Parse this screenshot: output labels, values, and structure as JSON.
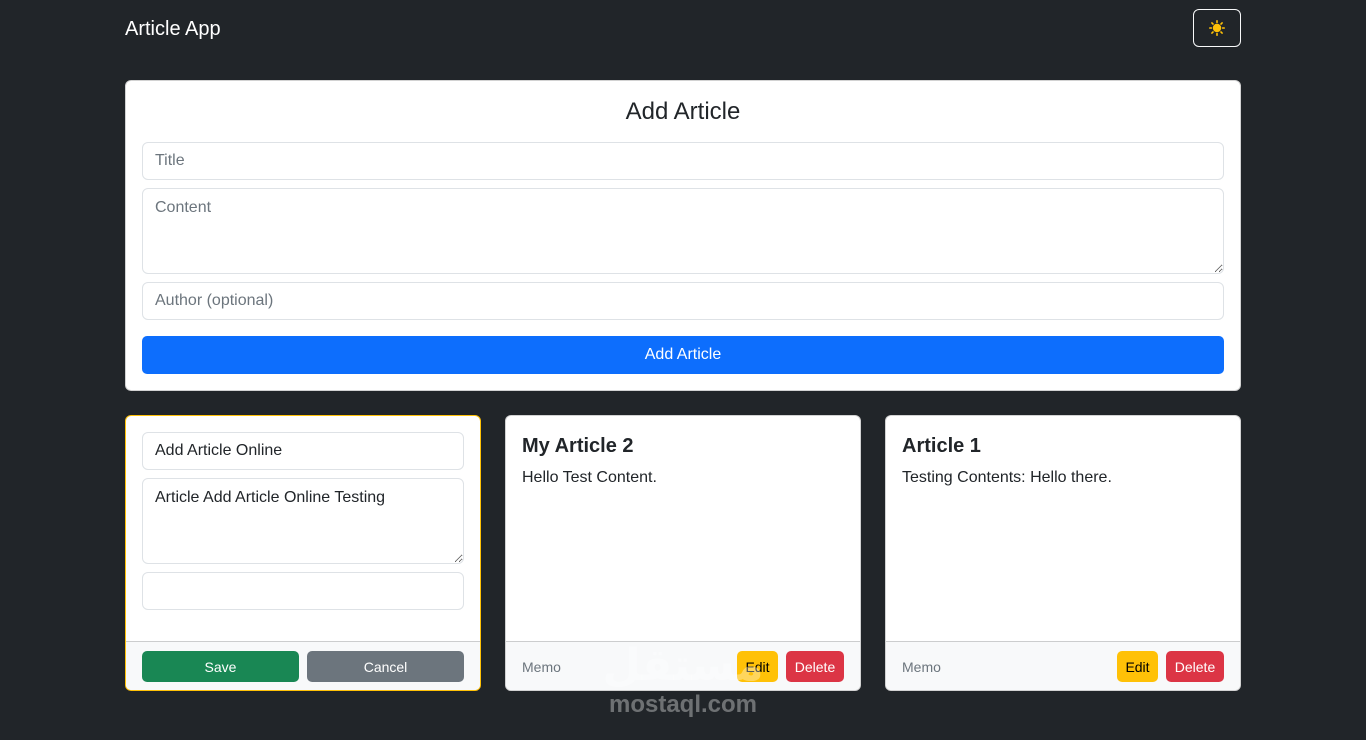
{
  "navbar": {
    "brand": "Article App",
    "theme_icon": "sun-icon",
    "accent": "#ffc107"
  },
  "add_form": {
    "heading": "Add Article",
    "title_placeholder": "Title",
    "content_placeholder": "Content",
    "author_placeholder": "Author (optional)",
    "submit_label": "Add Article"
  },
  "edit_card": {
    "title_value": "Add Article Online",
    "content_value": "Article Add Article Online Testing",
    "author_value": "",
    "save_label": "Save",
    "cancel_label": "Cancel"
  },
  "articles": [
    {
      "title": "My Article 2",
      "content": "Hello Test Content.",
      "author": "Memo",
      "edit_label": "Edit",
      "delete_label": "Delete"
    },
    {
      "title": "Article 1",
      "content": "Testing Contents: Hello there.",
      "author": "Memo",
      "edit_label": "Edit",
      "delete_label": "Delete"
    }
  ],
  "watermark": {
    "logo": "مستقل",
    "text": "mostaql.com"
  },
  "colors": {
    "background": "#212529",
    "primary": "#0d6efd",
    "success": "#198754",
    "secondary": "#6c757d",
    "warning": "#ffc107",
    "danger": "#dc3545"
  }
}
